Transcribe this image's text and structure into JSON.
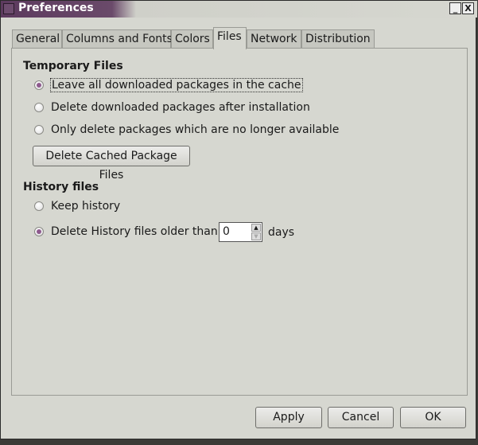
{
  "window": {
    "title": "Preferences",
    "minimize": "_",
    "close": "X"
  },
  "tabs": [
    "General",
    "Columns and Fonts",
    "Colors",
    "Files",
    "Network",
    "Distribution"
  ],
  "active_tab": "Files",
  "temporary": {
    "heading": "Temporary Files",
    "options": [
      "Leave all downloaded packages in the cache",
      "Delete downloaded packages after installation",
      "Only delete packages which are no longer available"
    ],
    "selected": 0,
    "delete_button": "Delete Cached Package Files"
  },
  "history": {
    "heading": "History files",
    "options": [
      "Keep history",
      "Delete History files older than:"
    ],
    "selected": 1,
    "days_value": "0",
    "days_unit": "days"
  },
  "buttons": {
    "apply": "Apply",
    "cancel": "Cancel",
    "ok": "OK"
  },
  "colors": {
    "accent": "#8e5a8e",
    "titlebar": "#5c3a5e"
  }
}
